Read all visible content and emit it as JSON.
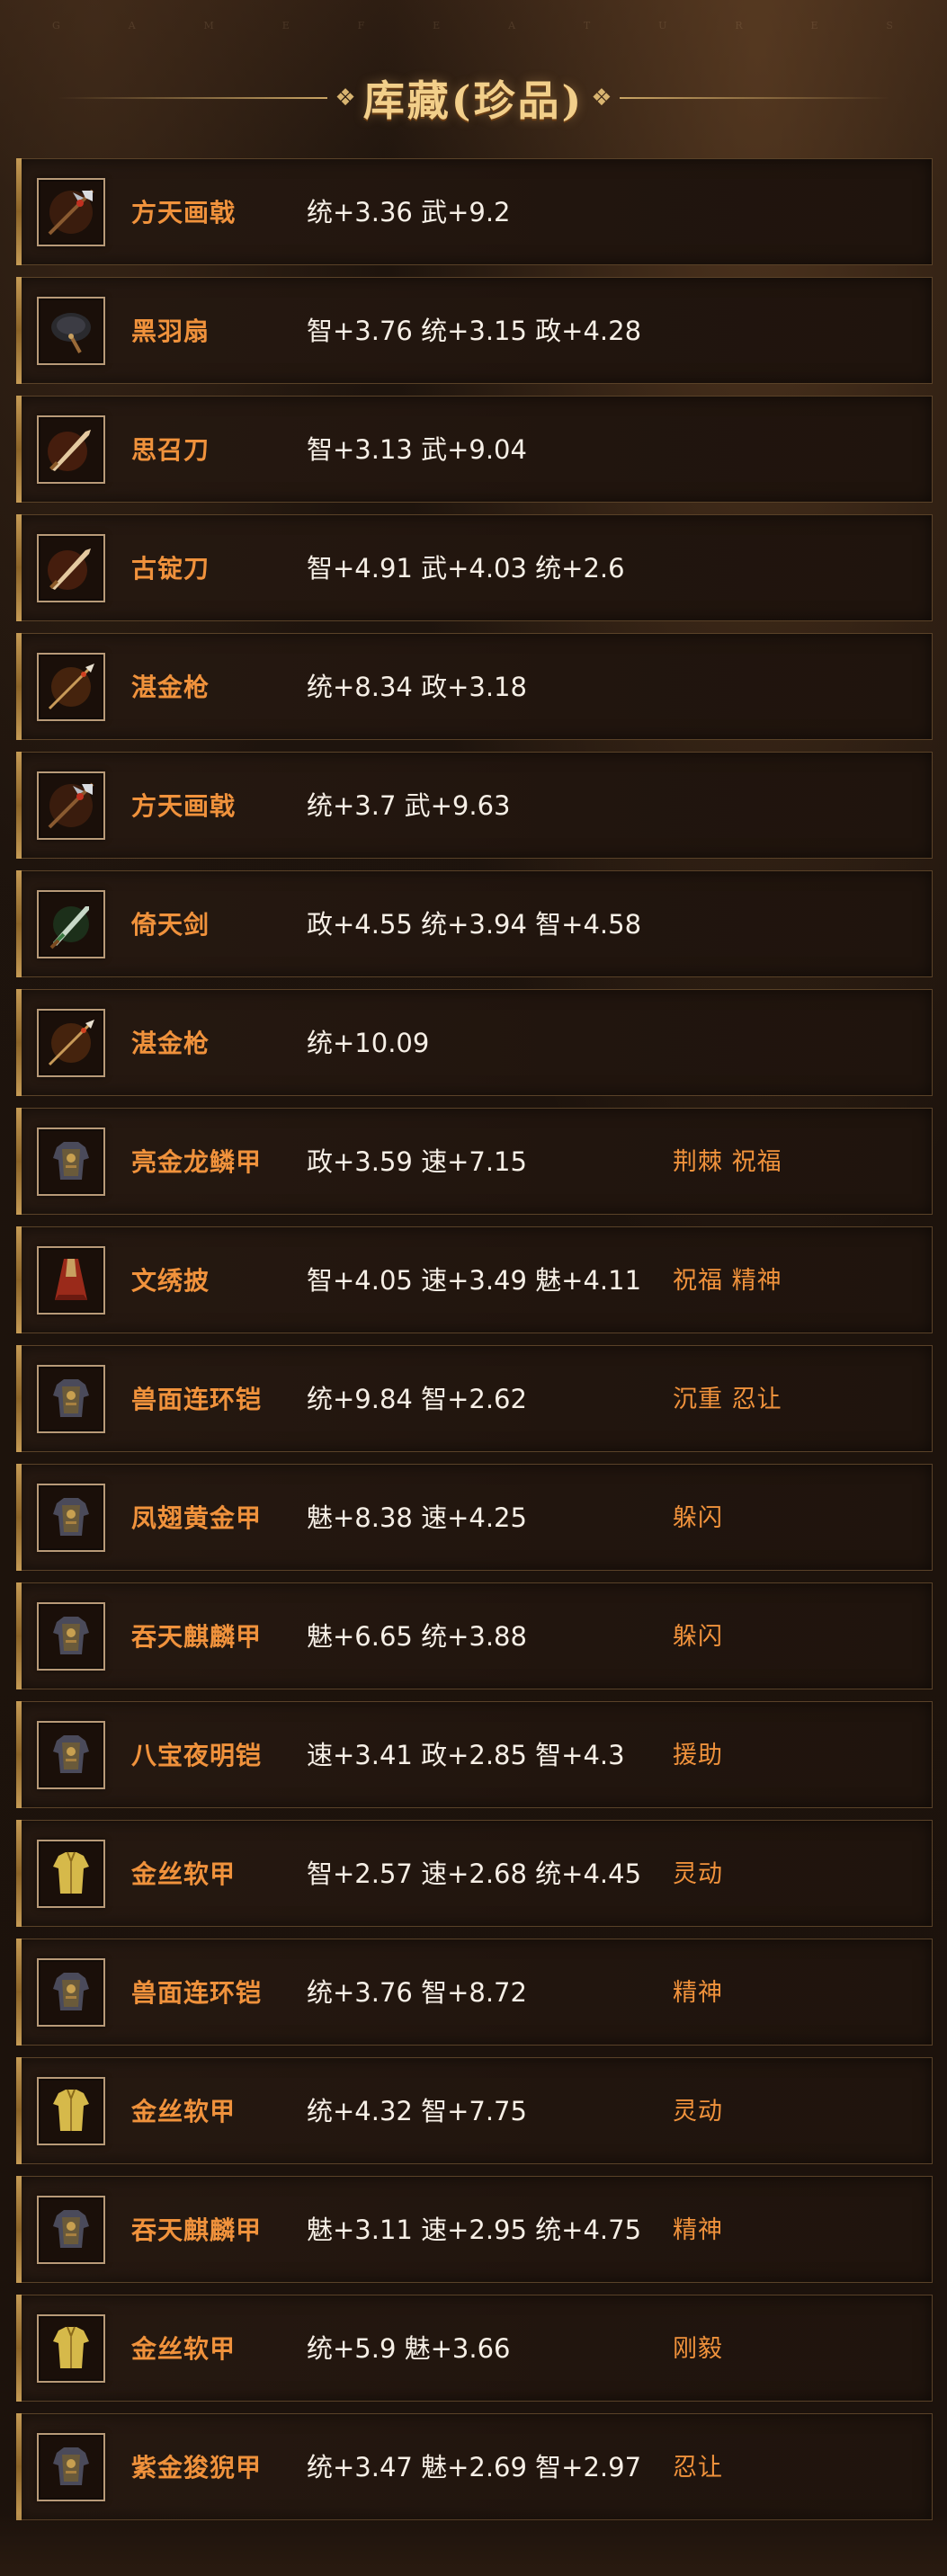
{
  "watermark": [
    "G",
    "A",
    "M",
    "E",
    "F",
    "E",
    "A",
    "T",
    "U",
    "R",
    "E",
    "S"
  ],
  "header": {
    "title": "库藏(珍品)"
  },
  "items": [
    {
      "name": "方天画戟",
      "stats": "统+3.36 武+9.2",
      "skills": "",
      "icon": "halberd-icon"
    },
    {
      "name": "黑羽扇",
      "stats": "智+3.76 统+3.15 政+4.28",
      "skills": "",
      "icon": "feather-fan-icon"
    },
    {
      "name": "思召刀",
      "stats": "智+3.13 武+9.04",
      "skills": "",
      "icon": "blade-icon"
    },
    {
      "name": "古锭刀",
      "stats": "智+4.91 武+4.03 统+2.6",
      "skills": "",
      "icon": "blade-icon"
    },
    {
      "name": "湛金枪",
      "stats": "统+8.34 政+3.18",
      "skills": "",
      "icon": "spear-icon"
    },
    {
      "name": "方天画戟",
      "stats": "统+3.7 武+9.63",
      "skills": "",
      "icon": "halberd-icon"
    },
    {
      "name": "倚天剑",
      "stats": "政+4.55 统+3.94 智+4.58",
      "skills": "",
      "icon": "sword-icon"
    },
    {
      "name": "湛金枪",
      "stats": "统+10.09",
      "skills": "",
      "icon": "spear-icon"
    },
    {
      "name": "亮金龙鳞甲",
      "stats": "政+3.59 速+7.15",
      "skills": "荆棘 祝福",
      "icon": "armor-icon"
    },
    {
      "name": "文绣披",
      "stats": "智+4.05 速+3.49 魅+4.11",
      "skills": "祝福 精神",
      "icon": "cloak-icon"
    },
    {
      "name": "兽面连环铠",
      "stats": "统+9.84 智+2.62",
      "skills": "沉重 忍让",
      "icon": "armor-icon"
    },
    {
      "name": "凤翅黄金甲",
      "stats": "魅+8.38 速+4.25",
      "skills": "躲闪",
      "icon": "armor-icon"
    },
    {
      "name": "吞天麒麟甲",
      "stats": "魅+6.65 统+3.88",
      "skills": "躲闪",
      "icon": "armor-icon"
    },
    {
      "name": "八宝夜明铠",
      "stats": "速+3.41 政+2.85 智+4.3",
      "skills": "援助",
      "icon": "armor-icon"
    },
    {
      "name": "金丝软甲",
      "stats": "智+2.57 速+2.68 统+4.45",
      "skills": "灵动",
      "icon": "vest-icon"
    },
    {
      "name": "兽面连环铠",
      "stats": "统+3.76 智+8.72",
      "skills": "精神",
      "icon": "armor-icon"
    },
    {
      "name": "金丝软甲",
      "stats": "统+4.32 智+7.75",
      "skills": "灵动",
      "icon": "vest-icon"
    },
    {
      "name": "吞天麒麟甲",
      "stats": "魅+3.11 速+2.95 统+4.75",
      "skills": "精神",
      "icon": "armor-icon"
    },
    {
      "name": "金丝软甲",
      "stats": "统+5.9 魅+3.66",
      "skills": "刚毅",
      "icon": "vest-icon"
    },
    {
      "name": "紫金狻猊甲",
      "stats": "统+3.47 魅+2.69 智+2.97",
      "skills": "忍让",
      "icon": "armor-icon"
    }
  ],
  "colors": {
    "name": "#f0923c",
    "skills": "#f0923c",
    "stats": "#f6efe6",
    "title": "#f2cf8a",
    "border": "#5a4228"
  }
}
